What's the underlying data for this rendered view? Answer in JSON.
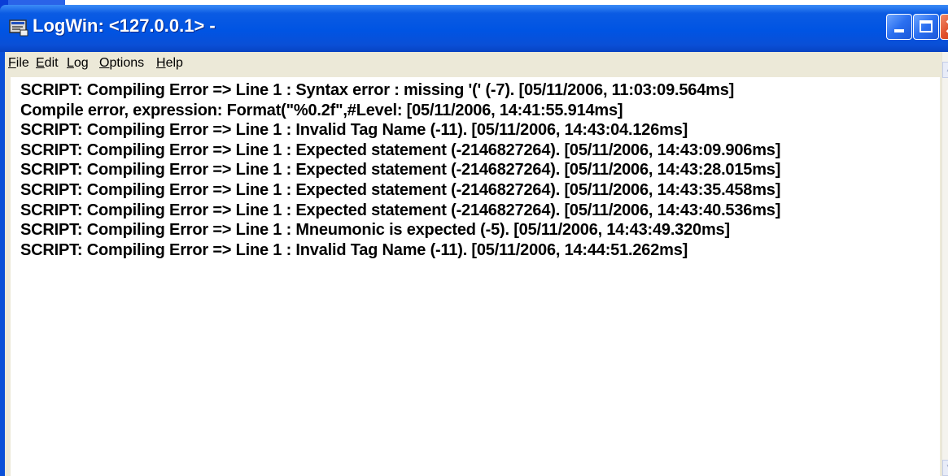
{
  "window": {
    "title": "LogWin: <127.0.0.1> -",
    "title_icon": "logwin-app-icon",
    "controls": [
      "minimize",
      "maximize",
      "close"
    ]
  },
  "menu": {
    "file": {
      "accel": "F",
      "rest": "ile"
    },
    "edit": {
      "accel": "E",
      "rest": "dit"
    },
    "log": {
      "accel": "L",
      "rest": "og"
    },
    "options": {
      "accel": "O",
      "rest": "ptions"
    },
    "help": {
      "accel": "H",
      "rest": "elp"
    }
  },
  "log_lines": [
    "SCRIPT: Compiling Error => Line 1 : Syntax error : missing '(' (-7). [05/11/2006, 11:03:09.564ms]",
    "Compile error, expression: Format(\"%0.2f\",#Level: [05/11/2006, 14:41:55.914ms]",
    "SCRIPT: Compiling Error => Line 1 : Invalid Tag Name (-11). [05/11/2006, 14:43:04.126ms]",
    "SCRIPT: Compiling Error => Line 1 : Expected statement (-2146827264). [05/11/2006, 14:43:09.906ms]",
    "SCRIPT: Compiling Error => Line 1 : Expected statement (-2146827264). [05/11/2006, 14:43:28.015ms]",
    "SCRIPT: Compiling Error => Line 1 : Expected statement (-2146827264). [05/11/2006, 14:43:35.458ms]",
    "SCRIPT: Compiling Error => Line 1 : Expected statement (-2146827264). [05/11/2006, 14:43:40.536ms]",
    "SCRIPT: Compiling Error => Line 1 : Mneumonic is expected (-5). [05/11/2006, 14:43:49.320ms]",
    "SCRIPT: Compiling Error => Line 1 : Invalid Tag Name (-11). [05/11/2006, 14:44:51.262ms]"
  ],
  "colors": {
    "titlebar": "#0054e3",
    "close_button": "#e0502a",
    "menubar": "#ece9d8",
    "log_background": "#ffffff",
    "log_text": "#000000"
  }
}
